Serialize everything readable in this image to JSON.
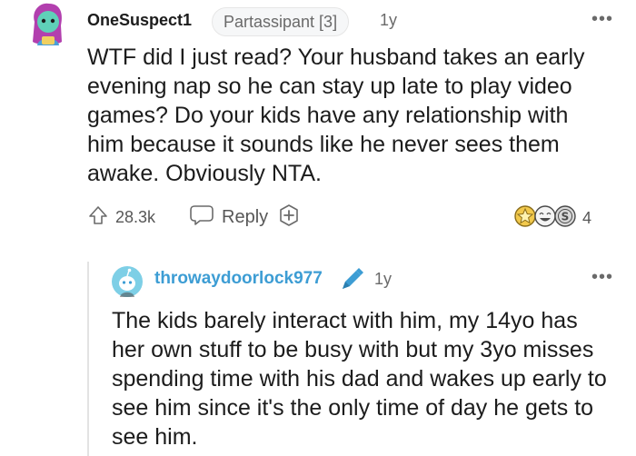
{
  "comment": {
    "username": "OneSuspect1",
    "flair": "Partassipant [3]",
    "age": "1y",
    "more": "•••",
    "body": "WTF did I just read? Your husband takes an early evening nap so he can stay up late to play video games? Do your kids have any relationship with him because it sounds like he never sees them awake. Obviously NTA.",
    "upvotes": "28.3k",
    "reply_label": "Reply",
    "award_count": "4",
    "colors": {
      "avatar_hair": "#b23fae",
      "avatar_skin": "#5fd0b8"
    }
  },
  "reply": {
    "username": "throwaydoorlock977",
    "age": "1y",
    "more": "•••",
    "body": "The kids barely interact with him, my 14yo has her own stuff to be busy with but my 3yo misses spending time with his dad and wakes up early to see him since it's the only time of day he gets to see him.",
    "colors": {
      "username": "#3d9dd4",
      "avatar_bg": "#7ecfe6"
    }
  }
}
